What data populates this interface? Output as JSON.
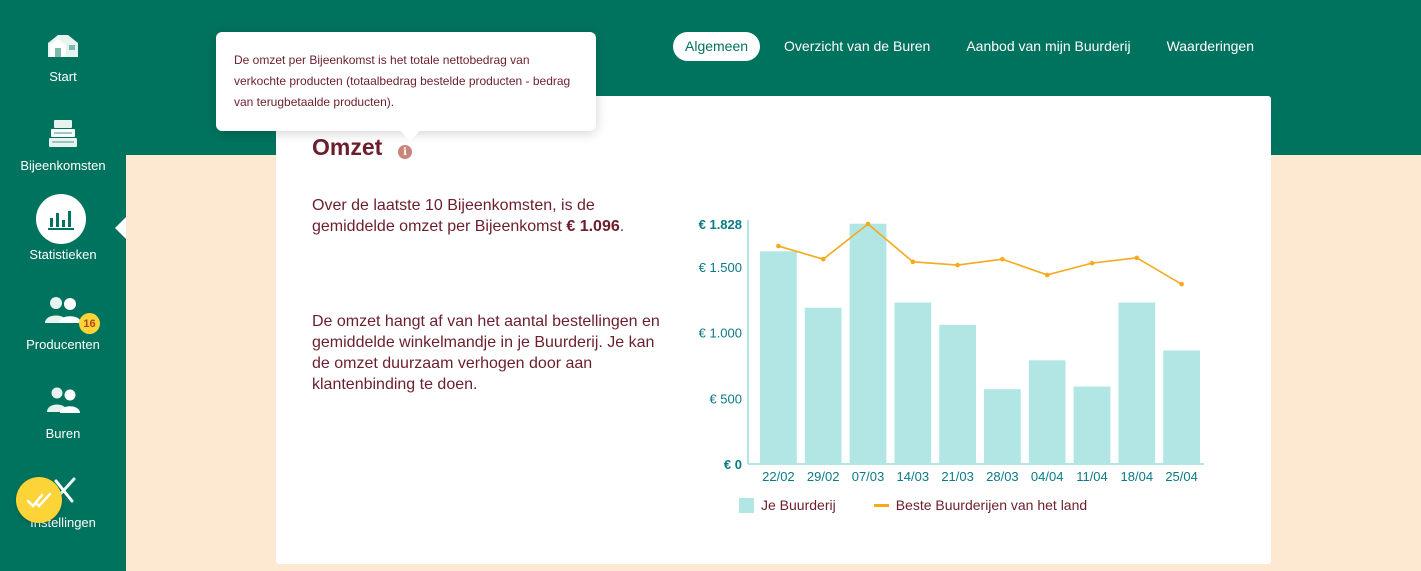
{
  "sidebar": {
    "items": [
      {
        "label": "Start",
        "icon": "farm-icon"
      },
      {
        "label": "Bijeenkomsten",
        "icon": "crates-icon"
      },
      {
        "label": "Statistieken",
        "icon": "chart-icon"
      },
      {
        "label": "Producenten",
        "icon": "producers-icon"
      },
      {
        "label": "Buren",
        "icon": "neighbours-icon"
      },
      {
        "label": "Instellingen",
        "icon": "settings-icon"
      }
    ],
    "producers_badge": "16"
  },
  "tabs": [
    {
      "label": "Algemeen",
      "active": true
    },
    {
      "label": "Overzicht van de Buren"
    },
    {
      "label": "Aanbod van mijn Buurderij"
    },
    {
      "label": "Waarderingen"
    }
  ],
  "tooltip": {
    "text": "De omzet per Bijeenkomst is het totale nettobedrag van verkochte producten (totaalbedrag bestelde producten - bedrag van terugbetaalde producten)."
  },
  "card": {
    "title": "Omzet",
    "para1_text": "Over de laatste 10 Bijeenkomsten, is de gemiddelde omzet per Bijeenkomst ",
    "para1_value": "€ 1.096",
    "para1_end": ".",
    "para2": "De omzet hangt af van het aantal bestellingen en gemiddelde winkelmandje in je Buurderij. Je kan de omzet duurzaam verhogen door aan klantenbinding te doen."
  },
  "chart_data": {
    "type": "bar",
    "categories": [
      "22/02",
      "29/02",
      "07/03",
      "14/03",
      "21/03",
      "28/03",
      "04/04",
      "11/04",
      "18/04",
      "25/04"
    ],
    "series": [
      {
        "name": "Je Buurderij",
        "type": "bar",
        "values": [
          1620,
          1190,
          1830,
          1230,
          1060,
          570,
          790,
          590,
          1230,
          865
        ]
      },
      {
        "name": "Beste Buurderijen van het land",
        "type": "line",
        "values": [
          1660,
          1560,
          1828,
          1540,
          1515,
          1560,
          1440,
          1530,
          1570,
          1370
        ]
      }
    ],
    "y_ticks": [
      {
        "value": 0,
        "label": "€ 0"
      },
      {
        "value": 500,
        "label": "€ 500"
      },
      {
        "value": 1000,
        "label": "€ 1.000"
      },
      {
        "value": 1500,
        "label": "€ 1.500"
      },
      {
        "value": 1828,
        "label": "€ 1.828"
      }
    ],
    "ylim": [
      0,
      1828
    ],
    "colors": {
      "bar": "#b2e6e5",
      "line": "#f5a91b",
      "axis": "#b2e6e5",
      "tick": "#0a7a86"
    }
  }
}
